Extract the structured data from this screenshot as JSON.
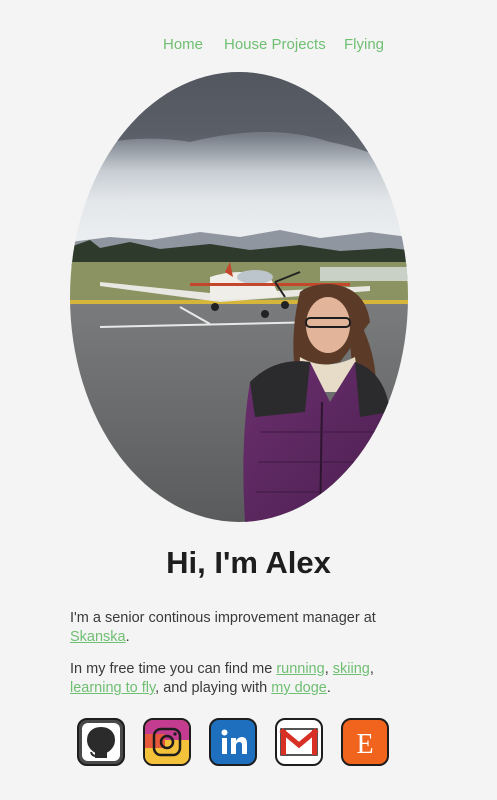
{
  "nav": {
    "items": [
      {
        "label": "Home"
      },
      {
        "label": "House Projects"
      },
      {
        "label": "Flying"
      }
    ]
  },
  "hero": {
    "photo_alt": "Woman in purple jacket standing in front of small airplane on runway"
  },
  "heading": "Hi, I'm Alex",
  "bio": {
    "p1_text": "I'm a senior continous improvement manager at ",
    "p1_link": "Skanska",
    "p1_end": ".",
    "p2_text": "In my free time you can find me ",
    "p2_link1": "running",
    "p2_sep1": ", ",
    "p2_link2": "skiing",
    "p2_sep2": ", ",
    "p2_link3": "learning to fly",
    "p2_mid": ", and playing with ",
    "p2_link4": "my doge",
    "p2_end": "."
  },
  "social": [
    {
      "icon": "github-icon",
      "color": "#555555"
    },
    {
      "icon": "instagram-icon",
      "color": "#e1306c"
    },
    {
      "icon": "linkedin-icon",
      "color": "#0a66c2"
    },
    {
      "icon": "gmail-icon",
      "color": "#d93025"
    },
    {
      "icon": "etsy-icon",
      "color": "#f1641e"
    }
  ],
  "colors": {
    "accent": "#6fbf73",
    "background": "#f4f4f4",
    "heading": "#1d1d1d"
  }
}
